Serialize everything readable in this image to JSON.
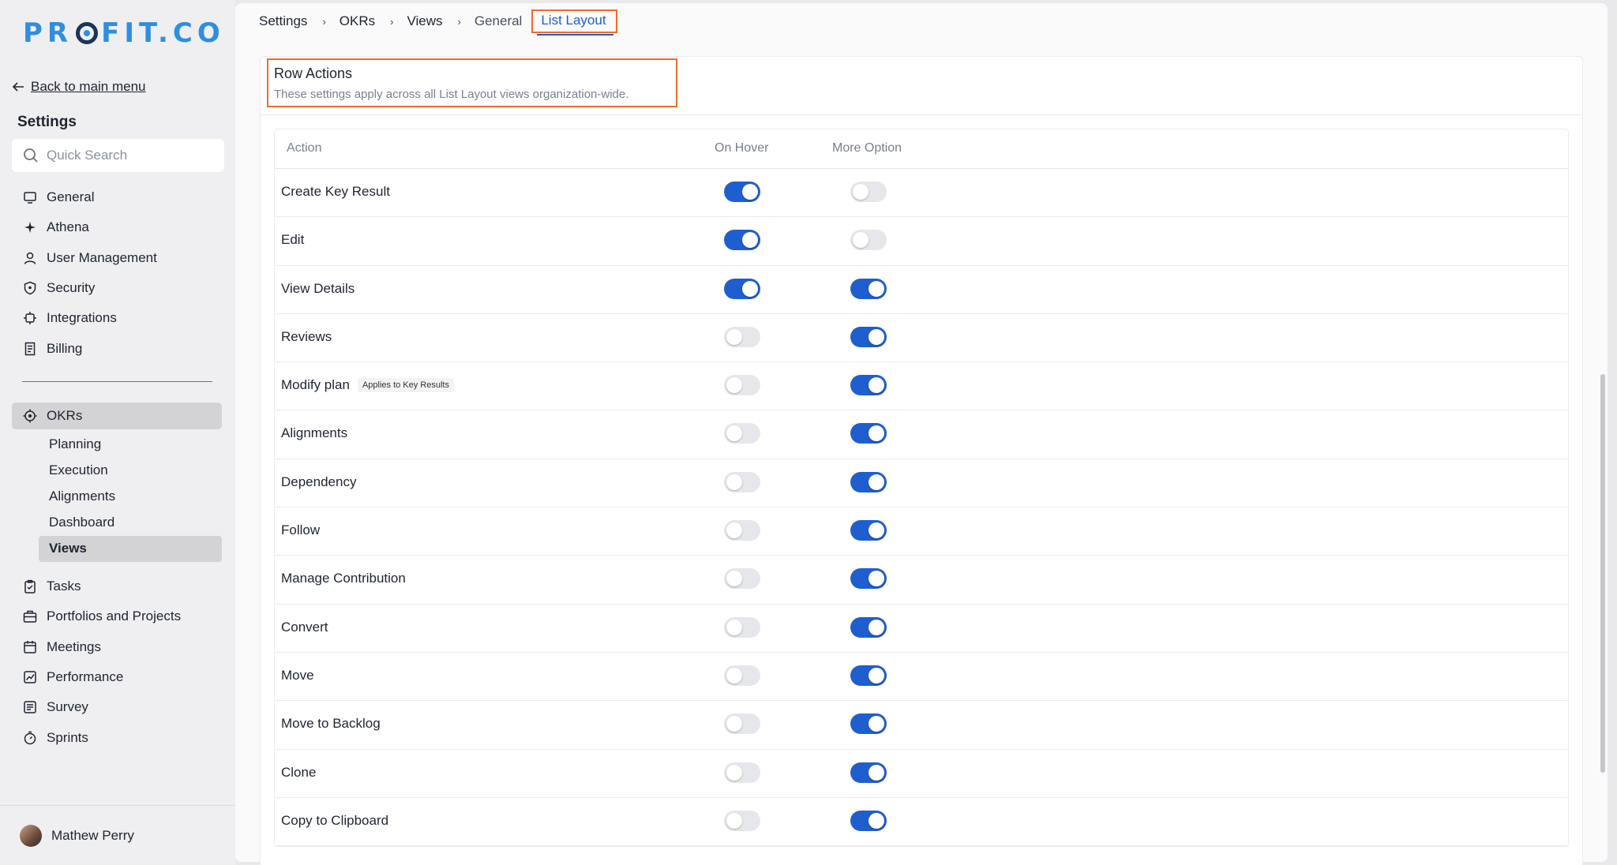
{
  "brand": {
    "logo_left": "PR",
    "logo_right": "FIT.CO"
  },
  "sidebar": {
    "back_label": "Back to main menu",
    "title": "Settings",
    "search_placeholder": "Quick Search",
    "items": [
      {
        "label": "General",
        "icon": "monitor-icon"
      },
      {
        "label": "Athena",
        "icon": "sparkle-icon"
      },
      {
        "label": "User Management",
        "icon": "user-icon"
      },
      {
        "label": "Security",
        "icon": "shield-icon"
      },
      {
        "label": "Integrations",
        "icon": "integrations-icon"
      },
      {
        "label": "Billing",
        "icon": "receipt-icon"
      }
    ],
    "okrs_label": "OKRs",
    "okrs_sub": [
      "Planning",
      "Execution",
      "Alignments",
      "Dashboard",
      "Views"
    ],
    "active_sub": "Views",
    "items2": [
      {
        "label": "Tasks",
        "icon": "clipboard-icon"
      },
      {
        "label": "Portfolios and Projects",
        "icon": "briefcase-icon"
      },
      {
        "label": "Meetings",
        "icon": "calendar-icon"
      },
      {
        "label": "Performance",
        "icon": "chart-icon"
      },
      {
        "label": "Survey",
        "icon": "survey-icon"
      },
      {
        "label": "Sprints",
        "icon": "stopwatch-icon"
      }
    ],
    "user_name": "Mathew Perry"
  },
  "breadcrumb": [
    "Settings",
    "OKRs",
    "Views",
    "General",
    "List Layout"
  ],
  "card": {
    "title": "Row Actions",
    "subtitle": "These settings apply across all List Layout views organization-wide."
  },
  "table": {
    "headers": {
      "action": "Action",
      "hover": "On Hover",
      "more": "More Option"
    },
    "rows": [
      {
        "action": "Create Key Result",
        "hover": true,
        "more": false,
        "badge": ""
      },
      {
        "action": "Edit",
        "hover": true,
        "more": false,
        "badge": ""
      },
      {
        "action": "View Details",
        "hover": true,
        "more": true,
        "badge": ""
      },
      {
        "action": "Reviews",
        "hover": false,
        "more": true,
        "badge": ""
      },
      {
        "action": "Modify plan",
        "hover": false,
        "more": true,
        "badge": "Applies to Key Results"
      },
      {
        "action": "Alignments",
        "hover": false,
        "more": true,
        "badge": ""
      },
      {
        "action": "Dependency",
        "hover": false,
        "more": true,
        "badge": ""
      },
      {
        "action": "Follow",
        "hover": false,
        "more": true,
        "badge": ""
      },
      {
        "action": "Manage Contribution",
        "hover": false,
        "more": true,
        "badge": ""
      },
      {
        "action": "Convert",
        "hover": false,
        "more": true,
        "badge": ""
      },
      {
        "action": "Move",
        "hover": false,
        "more": true,
        "badge": ""
      },
      {
        "action": "Move to Backlog",
        "hover": false,
        "more": true,
        "badge": ""
      },
      {
        "action": "Clone",
        "hover": false,
        "more": true,
        "badge": ""
      },
      {
        "action": "Copy to Clipboard",
        "hover": false,
        "more": true,
        "badge": ""
      }
    ]
  },
  "colors": {
    "accent": "#1f5ecf",
    "highlight": "#f26b2b",
    "brand": "#2f8ee0"
  }
}
